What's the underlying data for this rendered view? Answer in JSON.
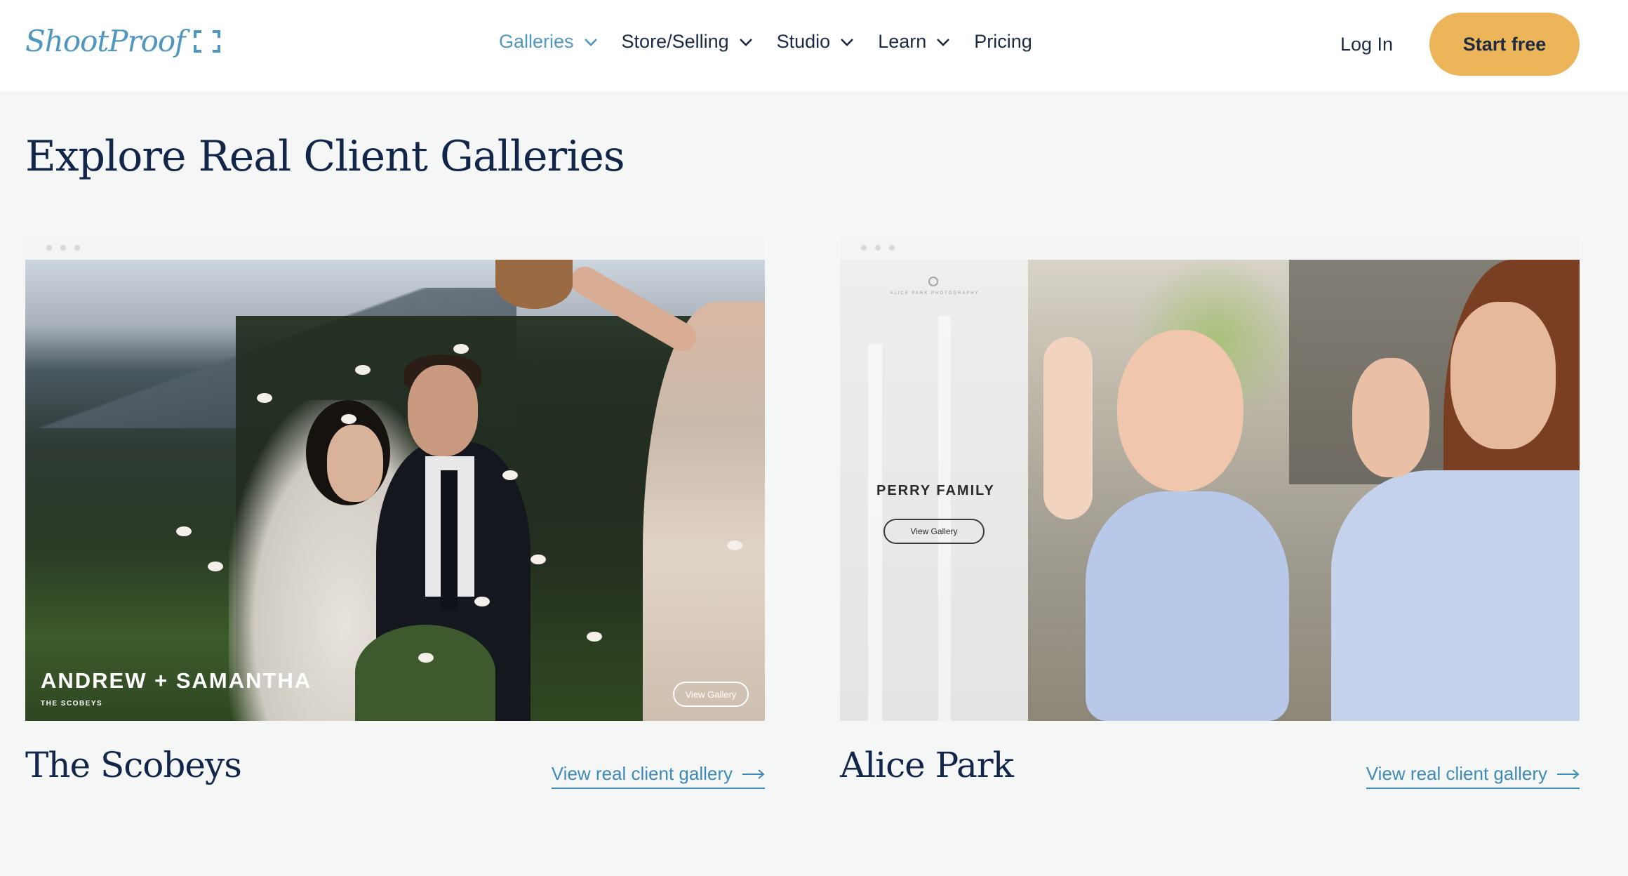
{
  "header": {
    "logo_text": "ShootProof",
    "nav": [
      {
        "label": "Galleries",
        "has_dropdown": true,
        "active": true
      },
      {
        "label": "Store/Selling",
        "has_dropdown": true,
        "active": false
      },
      {
        "label": "Studio",
        "has_dropdown": true,
        "active": false
      },
      {
        "label": "Learn",
        "has_dropdown": true,
        "active": false
      },
      {
        "label": "Pricing",
        "has_dropdown": false,
        "active": false
      }
    ],
    "login_label": "Log In",
    "cta_label": "Start free"
  },
  "main": {
    "title": "Explore Real Client Galleries",
    "galleries": [
      {
        "name": "The Scobeys",
        "link_label": "View real client gallery",
        "photo_title": "ANDREW + SAMANTHA",
        "photo_subtitle": "THE SCOBEYS",
        "photo_button": "View Gallery"
      },
      {
        "name": "Alice Park",
        "link_label": "View real client gallery",
        "photo_studio": "ALICE PARK PHOTOGRAPHY",
        "photo_title": "PERRY FAMILY",
        "photo_button": "View Gallery"
      }
    ]
  },
  "colors": {
    "brand_blue": "#4f97c0",
    "cta_yellow": "#edb55a",
    "heading_navy": "#12264a",
    "link_blue": "#3f8ab8",
    "page_bg": "#f5f7f7"
  },
  "icons": {
    "dropdown": "chevron-down-icon",
    "link_arrow": "arrow-right-icon",
    "logo_frame": "focus-frame-icon"
  }
}
